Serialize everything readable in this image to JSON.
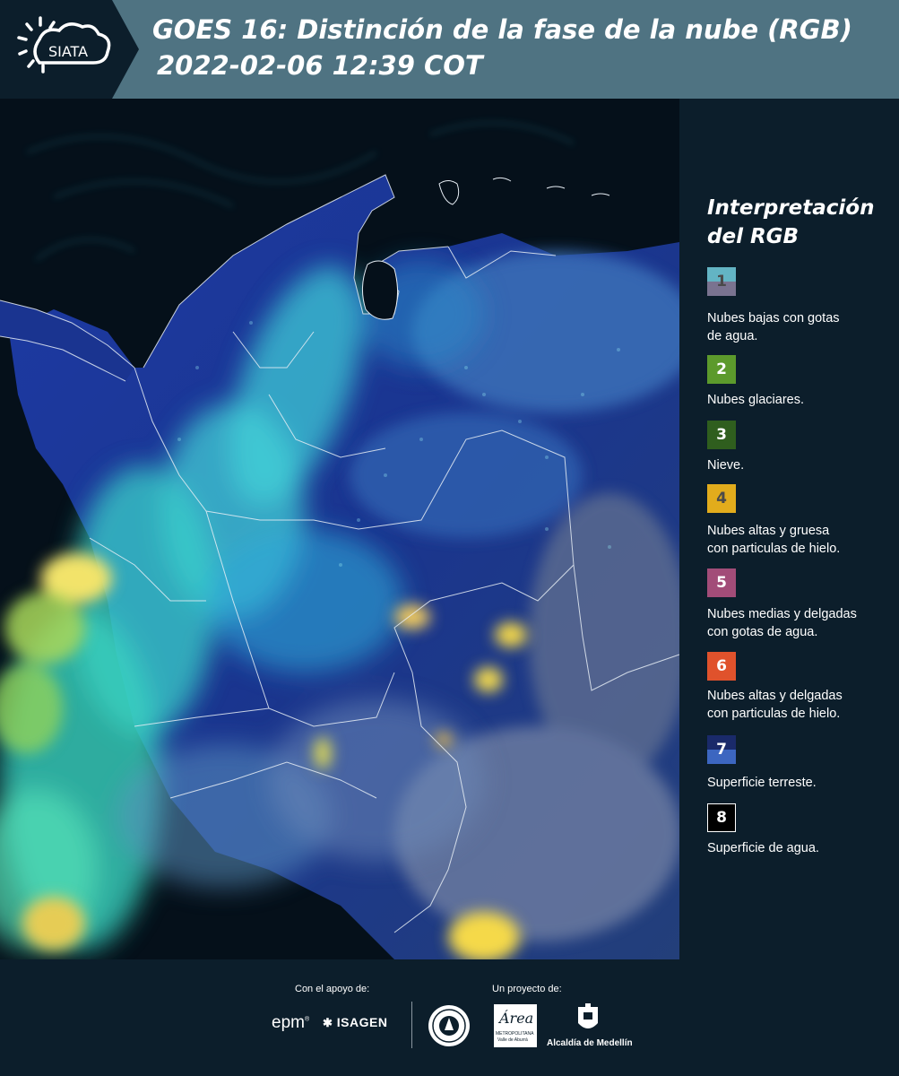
{
  "header": {
    "logo_text": "SIATA",
    "title_line1": "GOES 16: Distinción de la fase de la nube (RGB)",
    "title_line2": "2022-02-06 12:39 COT"
  },
  "legend": {
    "title_line1": "Interpretación",
    "title_line2": "del RGB",
    "items": [
      {
        "number": "1",
        "label_line1": "Nubes bajas con gotas",
        "label_line2": "de agua.",
        "color_top": "#63b4c4",
        "color_bottom": "#7a7390",
        "text_color": "#4a4a4a"
      },
      {
        "number": "2",
        "label_line1": "Nubes glaciares.",
        "label_line2": "",
        "color_top": "#5c9a2c",
        "color_bottom": "#5c9a2c",
        "text_color": "#ffffff"
      },
      {
        "number": "3",
        "label_line1": "Nieve.",
        "label_line2": "",
        "color_top": "#2f5e1e",
        "color_bottom": "#2f5e1e",
        "text_color": "#ffffff"
      },
      {
        "number": "4",
        "label_line1": "Nubes altas y gruesa",
        "label_line2": "con particulas de hielo.",
        "color_top": "#e2ac1c",
        "color_bottom": "#e2ac1c",
        "text_color": "#4a4a4a"
      },
      {
        "number": "5",
        "label_line1": "Nubes medias y delgadas",
        "label_line2": "con gotas de agua.",
        "color_top": "#a24c78",
        "color_bottom": "#a24c78",
        "text_color": "#ffffff"
      },
      {
        "number": "6",
        "label_line1": "Nubes altas y delgadas",
        "label_line2": "con particulas de hielo.",
        "color_top": "#e0522c",
        "color_bottom": "#e0522c",
        "text_color": "#ffffff"
      },
      {
        "number": "7",
        "label_line1": "Superficie terreste.",
        "label_line2": "",
        "color_top": "#1a2a6a",
        "color_bottom": "#3c66c0",
        "text_color": "#ffffff"
      },
      {
        "number": "8",
        "label_line1": "Superficie de agua.",
        "label_line2": "",
        "color_top": "#000000",
        "color_bottom": "#000000",
        "text_color": "#ffffff"
      }
    ]
  },
  "footer": {
    "support_label": "Con el apoyo de:",
    "project_label": "Un proyecto de:",
    "sponsor_epm": "epm",
    "sponsor_isagen": "ISAGEN",
    "area_metro_text": "Área",
    "area_metro_sub": "METROPOLITANA",
    "area_metro_sub2": "Valle de Aburrá",
    "alcaldia": "Alcaldía de Medellín"
  }
}
